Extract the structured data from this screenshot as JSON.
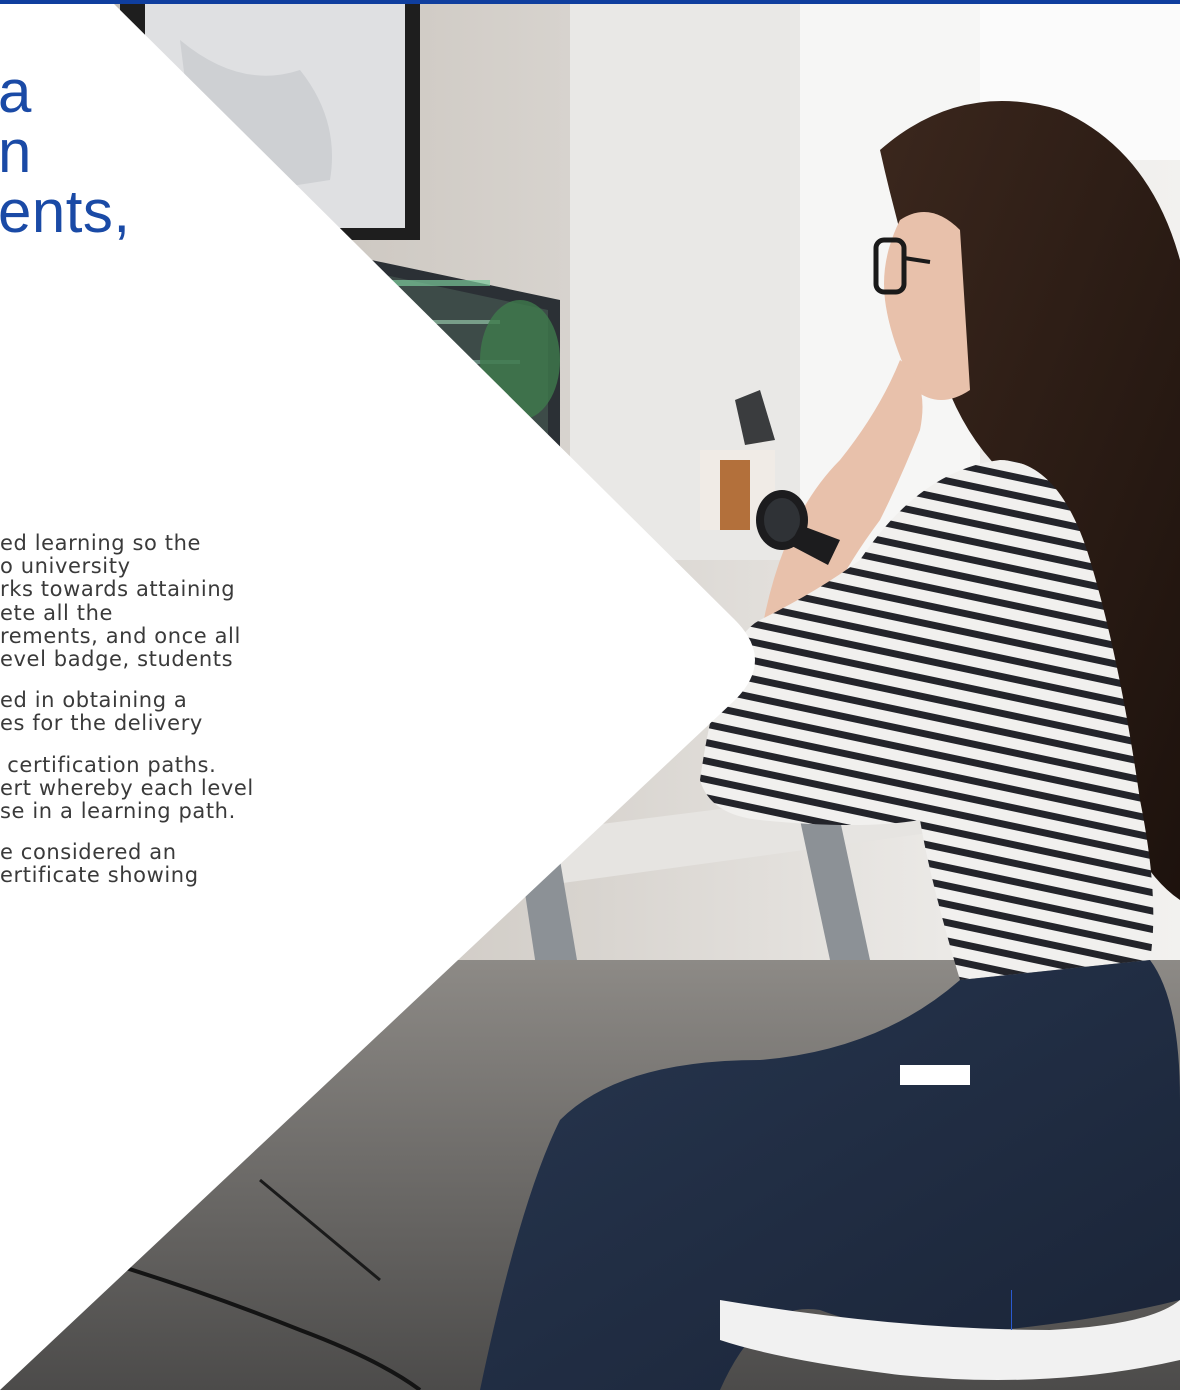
{
  "heading": {
    "lines": [
      "a",
      "n",
      "",
      "ents,"
    ]
  },
  "body": {
    "paragraphs": [
      "ed learning so the\no university\nrks towards attaining\nete all the\nrements, and once all\nevel badge, students",
      "ed in obtaining a\nes for the delivery",
      " certification paths.\nert whereby each level\nse in a learning path.",
      "e considered an\nertificate showing"
    ]
  },
  "colors": {
    "accent_blue": "#1a4aa6",
    "top_bar": "#0f3e9e",
    "body_text": "#3a3a3a"
  },
  "image": {
    "description_icon": "photo-woman-at-desk-icon"
  }
}
